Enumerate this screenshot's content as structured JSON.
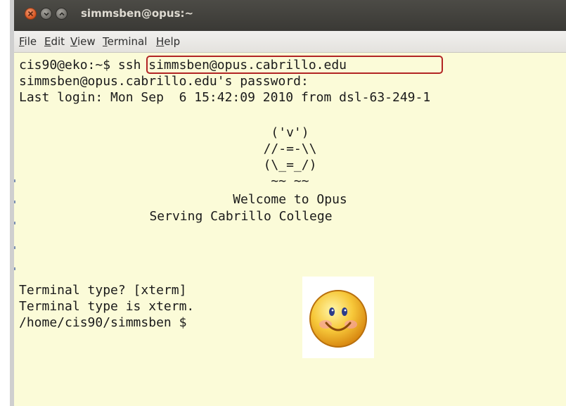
{
  "window": {
    "title": "simmsben@opus:~"
  },
  "menu": [
    {
      "mnemonic": "F",
      "rest": "ile"
    },
    {
      "mnemonic": "E",
      "rest": "dit"
    },
    {
      "mnemonic": "V",
      "rest": "iew"
    },
    {
      "mnemonic": "T",
      "rest": "erminal"
    },
    {
      "mnemonic": "H",
      "rest": "elp"
    }
  ],
  "terminal": {
    "prompt1": "cis90@eko:~$ ",
    "command": "ssh simmsben@opus.cabrillo.edu",
    "password_prompt": "simmsben@opus.cabrillo.edu's password:",
    "last_login": "Last login: Mon Sep  6 15:42:09 2010 from dsl-63-249-1",
    "banner": {
      "art1": "('v')",
      "art2": "//-=-\\\\",
      "art3": "(\\_=_/)",
      "art4": "~~ ~~",
      "welcome": "Welcome to Opus",
      "serving": "Serving Cabrillo College"
    },
    "term_type_query": "Terminal type? [xterm]",
    "term_type_set": "Terminal type is xterm.",
    "prompt2": "/home/cis90/simmsben $"
  },
  "colors": {
    "terminal_bg": "#fbfbd8",
    "title_bar": "#3c3b37",
    "highlight_box": "#b22424",
    "close_button": "#e0602a"
  }
}
